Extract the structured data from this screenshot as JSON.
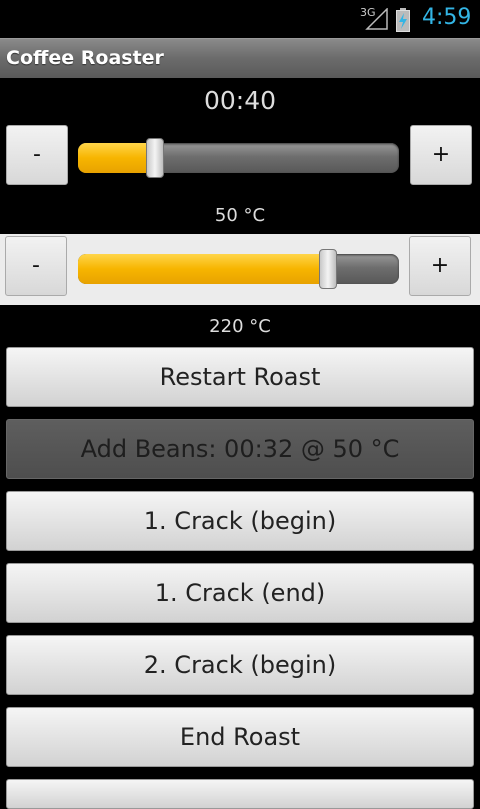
{
  "status_bar": {
    "network": "3G",
    "time": "4:59",
    "icons": [
      "signal-icon",
      "battery-charging-icon"
    ]
  },
  "app": {
    "title": "Coffee Roaster"
  },
  "timer": {
    "value": "00:40",
    "minus_label": "-",
    "plus_label": "+",
    "slider_fraction": 0.24
  },
  "temperature": {
    "current_label": "50 °C",
    "minus_label": "-",
    "plus_label": "+",
    "slider_fraction": 0.78,
    "target_label": "220 °C"
  },
  "actions": {
    "restart": "Restart Roast",
    "add_beans": "Add Beans: 00:32 @ 50 °C",
    "crack1_begin": "1. Crack (begin)",
    "crack1_end": "1. Crack (end)",
    "crack2_begin": "2. Crack (begin)",
    "end_roast": "End Roast"
  },
  "colors": {
    "accent": "#33b5e5",
    "slider_fill": "#f7b500"
  }
}
